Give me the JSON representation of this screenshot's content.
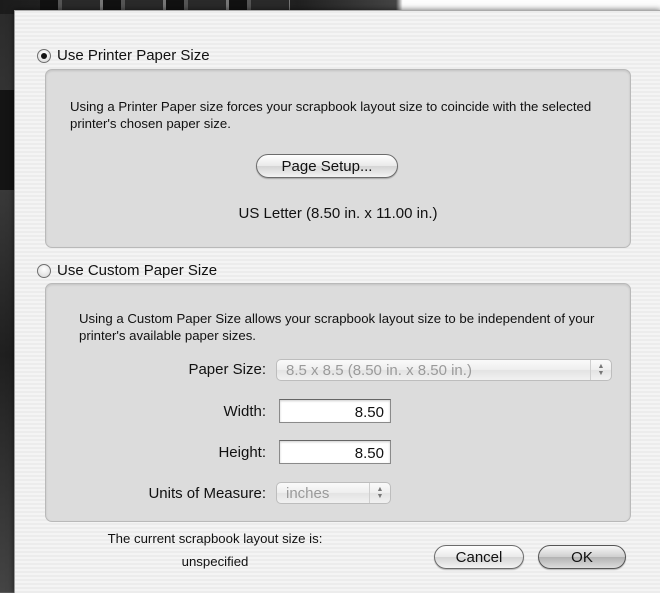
{
  "printer_section": {
    "radio_label": "Use Printer Paper Size",
    "selected": true,
    "description": "Using a Printer Paper size forces your scrapbook layout size to coincide with the selected printer's chosen paper size.",
    "page_setup_label": "Page Setup...",
    "current_paper": "US Letter (8.50 in. x 11.00 in.)"
  },
  "custom_section": {
    "radio_label": "Use Custom Paper Size",
    "selected": false,
    "description": "Using a Custom Paper Size allows your scrapbook layout size to be independent of your printer's available paper sizes.",
    "paper_size_label": "Paper Size:",
    "paper_size_value": "8.5 x 8.5 (8.50 in. x 8.50 in.)",
    "width_label": "Width:",
    "width_value": "8.50",
    "height_label": "Height:",
    "height_value": "8.50",
    "units_label": "Units of Measure:",
    "units_value": "inches"
  },
  "footer": {
    "status_line1": "The current scrapbook layout size is:",
    "status_line2": "unspecified",
    "cancel_label": "Cancel",
    "ok_label": "OK"
  },
  "icons": {
    "popup_arrows": "up-down-arrows-icon"
  }
}
